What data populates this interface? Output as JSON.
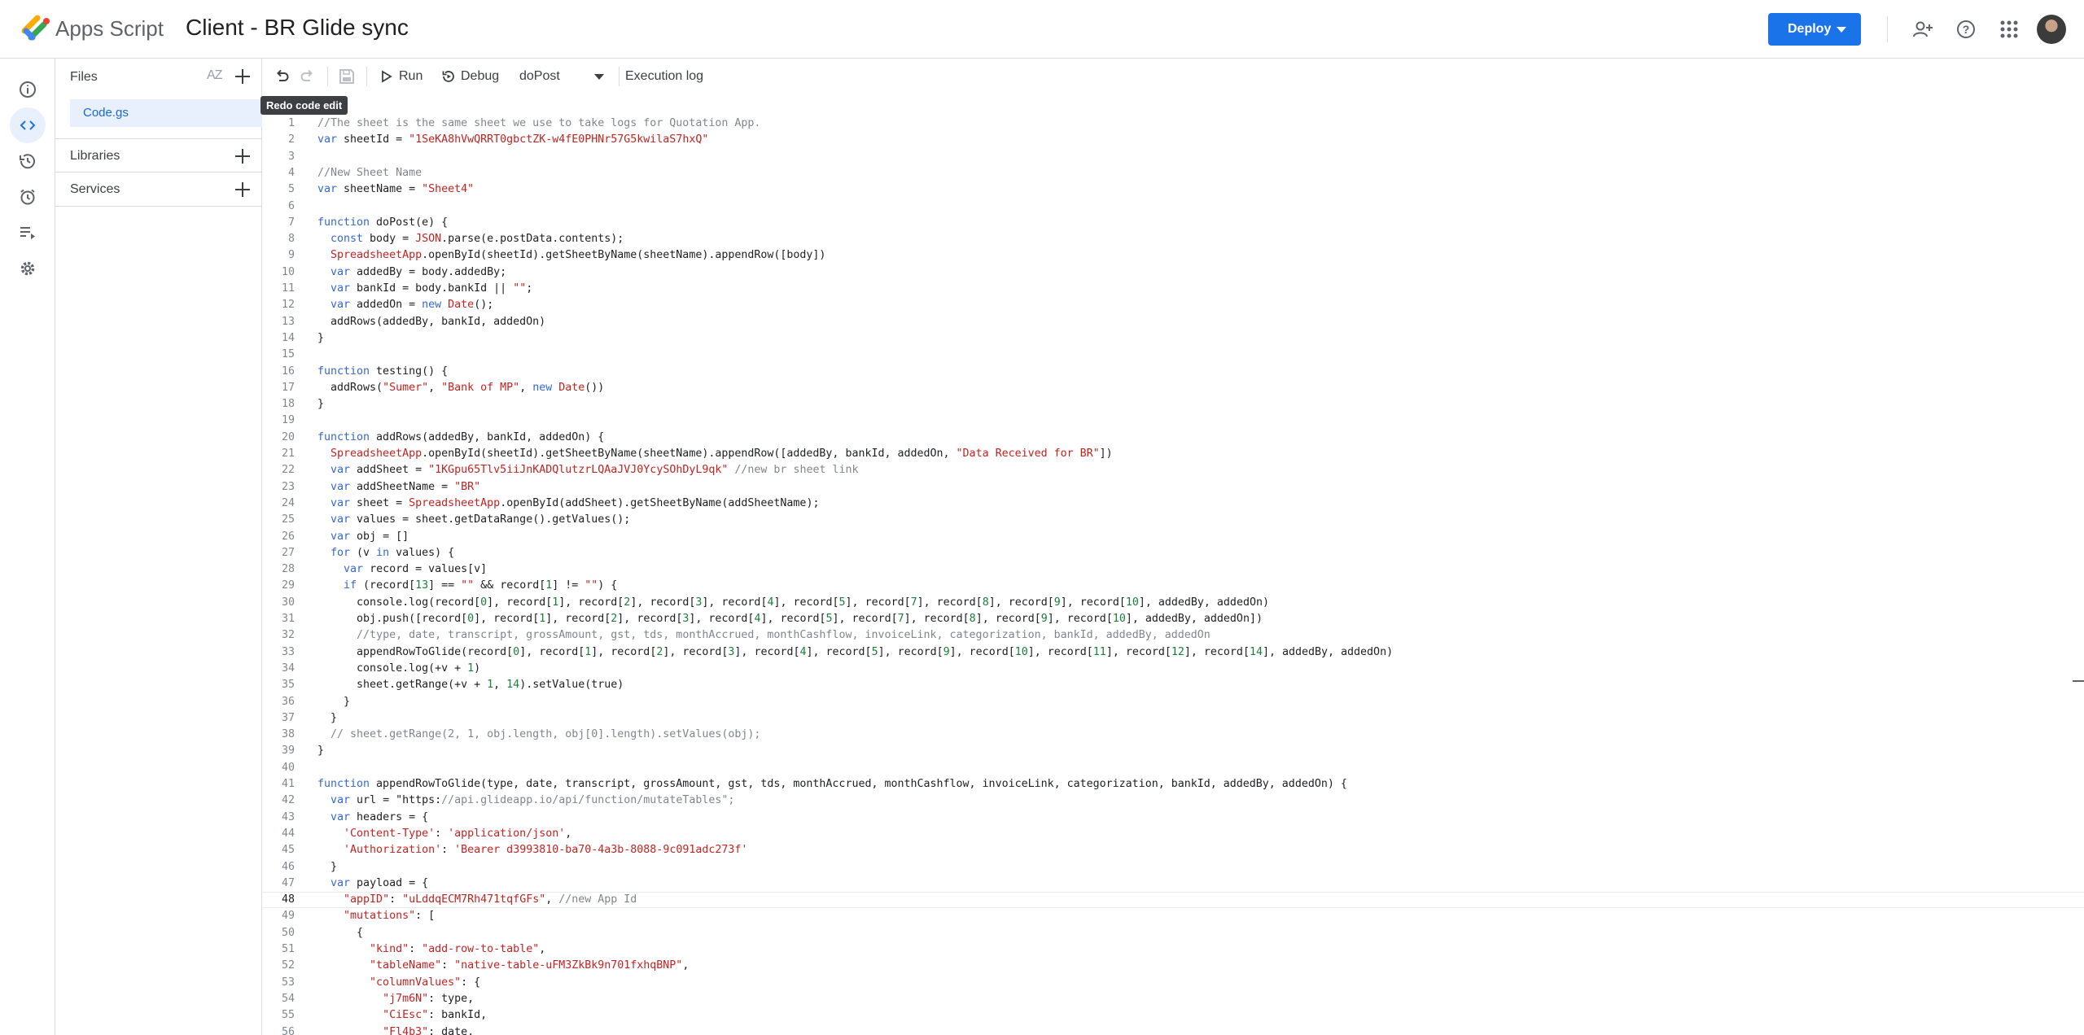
{
  "header": {
    "app_name": "Apps Script",
    "project_title": "Client - BR Glide sync",
    "deploy_label": "Deploy"
  },
  "rail": {
    "items": [
      "overview-icon",
      "editor-icon",
      "history-icon",
      "triggers-icon",
      "executions-icon",
      "settings-icon"
    ],
    "active": "editor-icon"
  },
  "files": {
    "title": "Files",
    "sort_label": "AZ",
    "items": [
      {
        "name": "Code.gs",
        "selected": true
      }
    ],
    "libraries_label": "Libraries",
    "services_label": "Services"
  },
  "toolbar": {
    "run_label": "Run",
    "debug_label": "Debug",
    "function_selected": "doPost",
    "execution_log_label": "Execution log",
    "tooltip": "Redo code edit"
  },
  "editor": {
    "active_line": 48,
    "lines": [
      "//The sheet is the same sheet we use to take logs for Quotation App.",
      "var sheetId = \"1SeKA8hVwQRRT0gbctZK-w4fE0PHNr57G5kwilaS7hxQ\"",
      "",
      "//New Sheet Name",
      "var sheetName = \"Sheet4\"",
      "",
      "function doPost(e) {",
      "  const body = JSON.parse(e.postData.contents);",
      "  SpreadsheetApp.openById(sheetId).getSheetByName(sheetName).appendRow([body])",
      "  var addedBy = body.addedBy;",
      "  var bankId = body.bankId || \"\";",
      "  var addedOn = new Date();",
      "  addRows(addedBy, bankId, addedOn)",
      "}",
      "",
      "function testing() {",
      "  addRows(\"Sumer\", \"Bank of MP\", new Date())",
      "}",
      "",
      "function addRows(addedBy, bankId, addedOn) {",
      "  SpreadsheetApp.openById(sheetId).getSheetByName(sheetName).appendRow([addedBy, bankId, addedOn, \"Data Received for BR\"])",
      "  var addSheet = \"1KGpu65Tlv5iiJnKADQlutzrLQAaJVJ0YcySOhDyL9qk\" //new br sheet link",
      "  var addSheetName = \"BR\"",
      "  var sheet = SpreadsheetApp.openById(addSheet).getSheetByName(addSheetName);",
      "  var values = sheet.getDataRange().getValues();",
      "  var obj = []",
      "  for (v in values) {",
      "    var record = values[v]",
      "    if (record[13] == \"\" && record[1] != \"\") {",
      "      console.log(record[0], record[1], record[2], record[3], record[4], record[5], record[7], record[8], record[9], record[10], addedBy, addedOn)",
      "      obj.push([record[0], record[1], record[2], record[3], record[4], record[5], record[7], record[8], record[9], record[10], addedBy, addedOn])",
      "      //type, date, transcript, grossAmount, gst, tds, monthAccrued, monthCashflow, invoiceLink, categorization, bankId, addedBy, addedOn",
      "      appendRowToGlide(record[0], record[1], record[2], record[3], record[4], record[5], record[9], record[10], record[11], record[12], record[14], addedBy, addedOn)",
      "      console.log(+v + 1)",
      "      sheet.getRange(+v + 1, 14).setValue(true)",
      "    }",
      "  }",
      "  // sheet.getRange(2, 1, obj.length, obj[0].length).setValues(obj);",
      "}",
      "",
      "function appendRowToGlide(type, date, transcript, grossAmount, gst, tds, monthAccrued, monthCashflow, invoiceLink, categorization, bankId, addedBy, addedOn) {",
      "  var url = \"https://api.glideapp.io/api/function/mutateTables\";",
      "  var headers = {",
      "    'Content-Type': 'application/json',",
      "    'Authorization': 'Bearer d3993810-ba70-4a3b-8088-9c091adc273f'",
      "  }",
      "  var payload = {",
      "    \"appID\": \"uLddqECM7Rh471tqfGFs\", //new App Id",
      "    \"mutations\": [",
      "      {",
      "        \"kind\": \"add-row-to-table\",",
      "        \"tableName\": \"native-table-uFM3ZkBk9n701fxhqBNP\",",
      "        \"columnValues\": {",
      "          \"j7m6N\": type,",
      "          \"CiEsc\": bankId,",
      "          \"Fl4b3\": date,"
    ]
  }
}
